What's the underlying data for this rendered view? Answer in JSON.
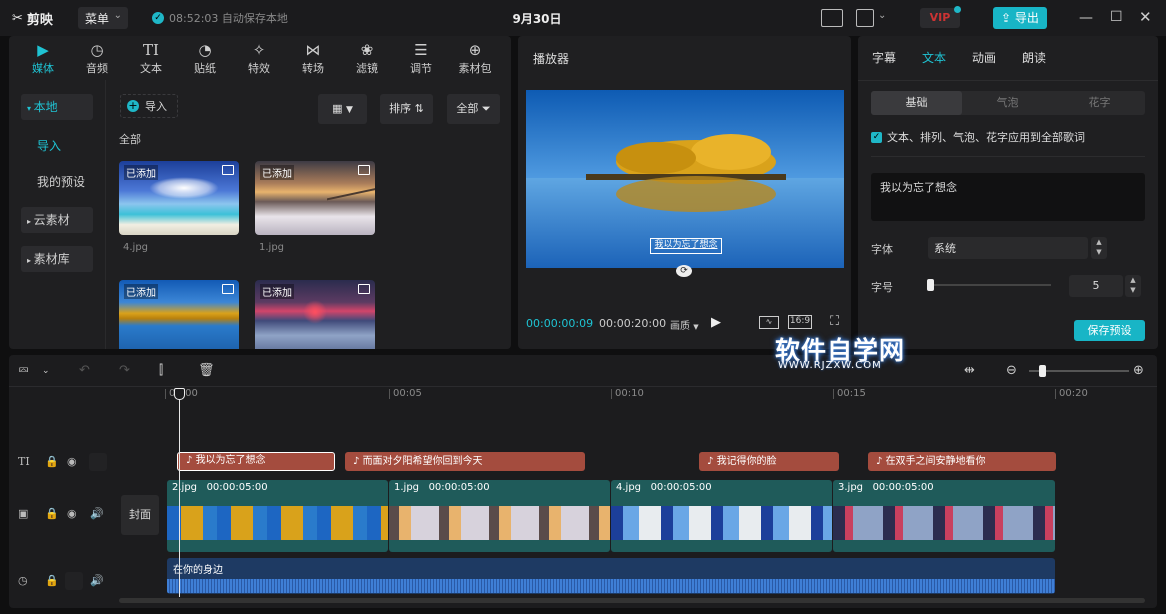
{
  "titlebar": {
    "app_name": "剪映",
    "menu_label": "菜单",
    "save_status": "08:52:03 自动保存本地",
    "project_name": "9月30日",
    "vip_label": "VIP",
    "export_label": "导出",
    "window_controls": [
      "minimize",
      "maximize",
      "close"
    ]
  },
  "media_panel": {
    "tabs": [
      {
        "label": "媒体",
        "icon": "media-icon"
      },
      {
        "label": "音频",
        "icon": "audio-icon"
      },
      {
        "label": "文本",
        "icon": "text-icon"
      },
      {
        "label": "贴纸",
        "icon": "sticker-icon"
      },
      {
        "label": "特效",
        "icon": "effects-icon"
      },
      {
        "label": "转场",
        "icon": "transition-icon"
      },
      {
        "label": "滤镜",
        "icon": "filter-icon"
      },
      {
        "label": "调节",
        "icon": "adjust-icon"
      },
      {
        "label": "素材包",
        "icon": "package-icon"
      }
    ],
    "active_tab": "媒体",
    "sidebar": {
      "local": "本地",
      "import": "导入",
      "my_presets": "我的预设",
      "cloud": "云素材",
      "library": "素材库"
    },
    "import_label": "导入",
    "sort_label": "排序",
    "filter_label": "全部",
    "section_label": "全部",
    "thumbnails": [
      {
        "name": "4.jpg",
        "badge": "已添加"
      },
      {
        "name": "1.jpg",
        "badge": "已添加"
      },
      {
        "name": "",
        "badge": "已添加"
      },
      {
        "name": "",
        "badge": "已添加"
      }
    ]
  },
  "player": {
    "title": "播放器",
    "subtitle_overlay": "我以为忘了想念",
    "current_time": "00:00:00:09",
    "total_time": "00:00:20:00",
    "quality": "画质",
    "aspect": "16:9"
  },
  "properties": {
    "tabs": [
      "字幕",
      "文本",
      "动画",
      "朗读"
    ],
    "active_tab": "文本",
    "segments": [
      "基础",
      "气泡",
      "花字"
    ],
    "active_segment": "基础",
    "apply_all": "文本、排列、气泡、花字应用到全部歌词",
    "text_value": "我以为忘了想念",
    "font_label": "字体",
    "font_value": "系统",
    "size_label": "字号",
    "size_value": "5",
    "size_fraction": 0.0,
    "save_preset": "保存预设"
  },
  "watermark": {
    "text": "软件自学网",
    "url": "WWW.RJZXW.COM"
  },
  "timeline": {
    "ticks": [
      "00:00",
      "00:05",
      "00:10",
      "00:15",
      "00:20"
    ],
    "cover_label": "封面",
    "text_clips": [
      {
        "text": "我以为忘了想念",
        "selected": true
      },
      {
        "text": "而面对夕阳希望你回到今天",
        "selected": false
      },
      {
        "text": "我记得你的脸",
        "selected": false
      },
      {
        "text": "在双手之间安静地看你",
        "selected": false
      }
    ],
    "video_clips": [
      {
        "name": "2.jpg",
        "duration": "00:00:05:00"
      },
      {
        "name": "1.jpg",
        "duration": "00:00:05:00"
      },
      {
        "name": "4.jpg",
        "duration": "00:00:05:00"
      },
      {
        "name": "3.jpg",
        "duration": "00:00:05:00"
      }
    ],
    "audio_clip": "在你的身边"
  },
  "colors": {
    "accent": "#1fc3d3",
    "text_clip": "#a44c3e",
    "video_clip": "#1f5b5a",
    "audio_clip": "#1e3a63"
  }
}
